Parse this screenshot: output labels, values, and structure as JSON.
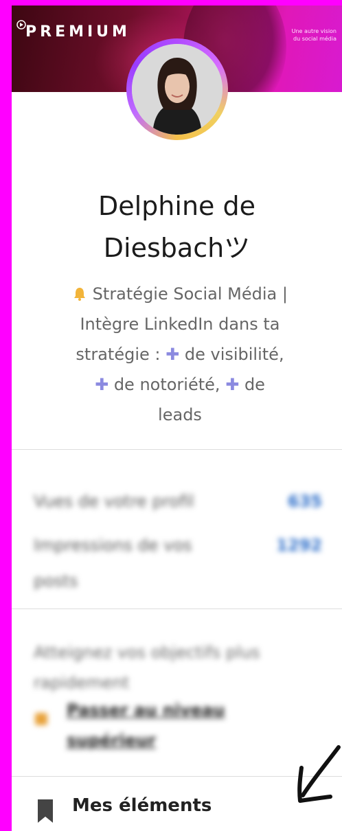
{
  "banner": {
    "premium_label": "PREMIUM",
    "tagline_line1": "Une autre vision",
    "tagline_line2": "du social média"
  },
  "profile": {
    "name_line1": "Delphine de",
    "name_line2": "Diesbachツ",
    "headline": {
      "part1": "Stratégie Social Média |",
      "part2": "Intègre LinkedIn dans ta",
      "part3": "stratégie :",
      "part4": "de visibilité,",
      "part5": "de notoriété,",
      "part6": "de",
      "part7": "leads"
    }
  },
  "stats": {
    "views_label": "Vues de votre profil",
    "views_value": "635",
    "impressions_label": "Impressions de vos posts",
    "impressions_value": "1292"
  },
  "promo": {
    "text": "Atteignez vos objectifs plus rapidement",
    "link": "Passer au niveau supérieur"
  },
  "items": {
    "label": "Mes éléments"
  },
  "colors": {
    "frame": "#ff00ff",
    "plus_icon": "#8b8ae0",
    "stat_value": "#2d6ec9"
  }
}
